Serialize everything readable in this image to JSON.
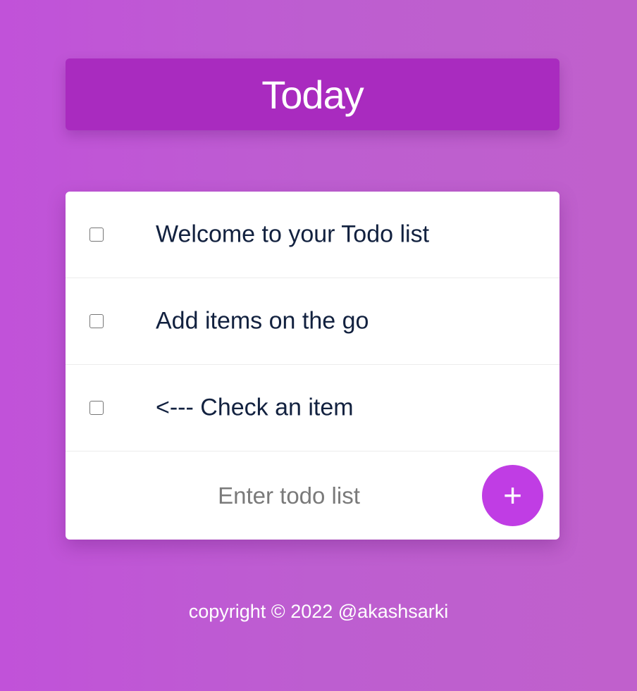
{
  "heading": {
    "title": "Today"
  },
  "todos": [
    {
      "text": "Welcome to your Todo list",
      "checked": false
    },
    {
      "text": "Add items on the go",
      "checked": false
    },
    {
      "text": "<--- Check an item",
      "checked": false
    }
  ],
  "form": {
    "placeholder": "Enter todo list",
    "value": "",
    "add_label": "+"
  },
  "footer": {
    "copyright": "copyright © 2022 @akashsarki"
  },
  "colors": {
    "background": "#bf5bd4",
    "heading_bg": "#a92bbf",
    "add_button": "#c03de4",
    "item_text": "#12213f"
  }
}
